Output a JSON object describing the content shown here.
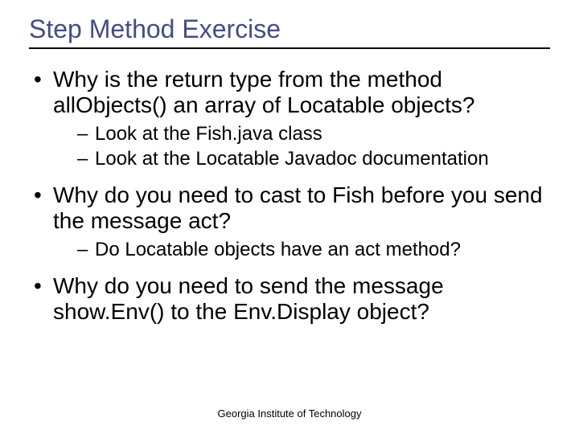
{
  "title": "Step Method Exercise",
  "bullets": [
    {
      "text": "Why is the return type from the method allObjects() an array of Locatable objects?",
      "sub": [
        "Look at the Fish.java class",
        "Look at the Locatable Javadoc documentation"
      ]
    },
    {
      "text": "Why do you need to cast to Fish before you send the message act?",
      "sub": [
        "Do Locatable objects have an act method?"
      ]
    },
    {
      "text": "Why do you need to send the message show.Env() to the Env.Display object?",
      "sub": []
    }
  ],
  "footer": "Georgia Institute of Technology"
}
